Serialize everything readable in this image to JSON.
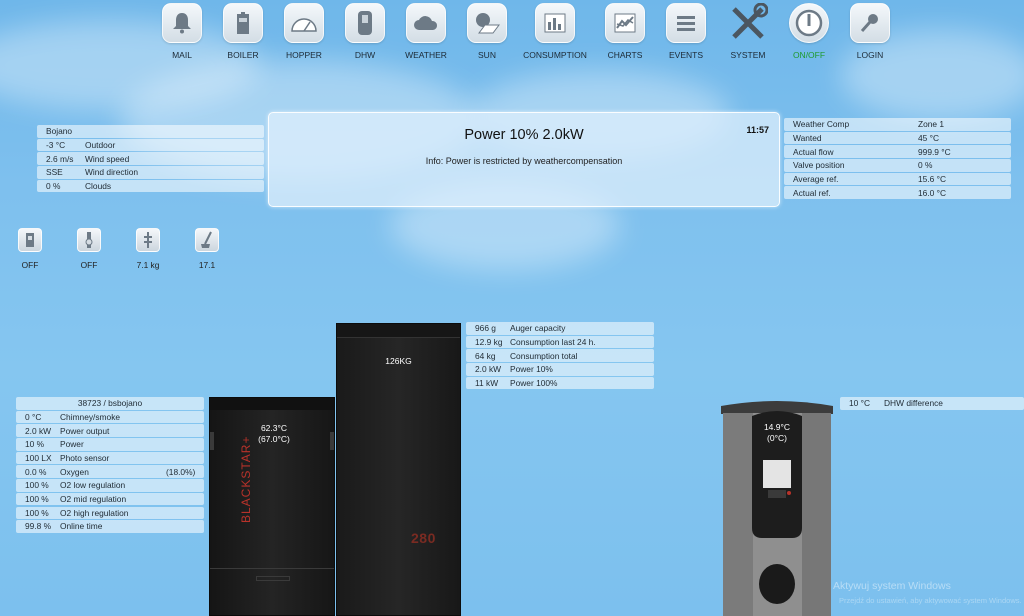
{
  "nav": {
    "items": [
      {
        "label": "MAIL",
        "icon": "bell-icon"
      },
      {
        "label": "BOILER",
        "icon": "boiler-icon"
      },
      {
        "label": "HOPPER",
        "icon": "gauge-icon"
      },
      {
        "label": "DHW",
        "icon": "water-tank-icon"
      },
      {
        "label": "WEATHER",
        "icon": "cloud-icon"
      },
      {
        "label": "SUN",
        "icon": "sun-panel-icon"
      },
      {
        "label": "CONSUMPTION",
        "icon": "bar-chart-icon"
      },
      {
        "label": "CHARTS",
        "icon": "line-chart-icon"
      },
      {
        "label": "EVENTS",
        "icon": "list-icon"
      },
      {
        "label": "SYSTEM",
        "icon": "tools-icon"
      },
      {
        "label": "ON/OFF",
        "icon": "power-icon"
      },
      {
        "label": "LOGIN",
        "icon": "key-icon"
      }
    ]
  },
  "weather": {
    "location": "Bojano",
    "rows": [
      {
        "value": "-3 °C",
        "label": "Outdoor"
      },
      {
        "value": "2.6 m/s",
        "label": "Wind speed"
      },
      {
        "value": "SSE",
        "label": "Wind direction"
      },
      {
        "value": "0 %",
        "label": "Clouds"
      }
    ]
  },
  "info": {
    "title": "Power 10% 2.0kW",
    "time": "11:57",
    "message": "Info: Power is restricted by weathercompensation"
  },
  "weather_comp": {
    "rows": [
      {
        "label": "Weather Comp",
        "value": "Zone 1"
      },
      {
        "label": "Wanted",
        "value": "45 °C"
      },
      {
        "label": "Actual flow",
        "value": "999.9 °C"
      },
      {
        "label": "Valve position",
        "value": "0 %"
      },
      {
        "label": "Average ref.",
        "value": "15.6 °C"
      },
      {
        "label": "Actual ref.",
        "value": "16.0 °C"
      }
    ]
  },
  "devices": [
    {
      "label": "OFF",
      "icon": "pump-icon"
    },
    {
      "label": "OFF",
      "icon": "valve-icon"
    },
    {
      "label": "7.1 kg",
      "icon": "pellet-scale-icon"
    },
    {
      "label": "17.1",
      "icon": "sweeper-icon"
    }
  ],
  "hopper_stats": {
    "rows": [
      {
        "value": "966 g",
        "label": "Auger capacity"
      },
      {
        "value": "12.9 kg",
        "label": "Consumption last 24 h."
      },
      {
        "value": "64 kg",
        "label": "Consumption total"
      },
      {
        "value": "2.0 kW",
        "label": "Power 10%"
      },
      {
        "value": "11 kW",
        "label": "Power 100%"
      }
    ]
  },
  "boiler_stats": {
    "header": "38723 / bsbojano",
    "rows": [
      {
        "value": "0 °C",
        "label": "Chimney/smoke",
        "extra": ""
      },
      {
        "value": "2.0 kW",
        "label": "Power output",
        "extra": ""
      },
      {
        "value": "10 %",
        "label": "Power",
        "extra": ""
      },
      {
        "value": "100 LX",
        "label": "Photo sensor",
        "extra": ""
      },
      {
        "value": "0.0 %",
        "label": "Oxygen",
        "extra": "(18.0%)"
      },
      {
        "value": "100 %",
        "label": "O2 low regulation",
        "extra": ""
      },
      {
        "value": "100 %",
        "label": "O2 mid regulation",
        "extra": ""
      },
      {
        "value": "100 %",
        "label": "O2 high regulation",
        "extra": ""
      },
      {
        "value": "99.8 %",
        "label": "Online time",
        "extra": ""
      }
    ]
  },
  "hopper": {
    "weight": "126KG",
    "number": "280"
  },
  "boiler": {
    "temp": "62.3°C",
    "temp_target": "(67.0°C)",
    "brand": "BLACKSTAR+"
  },
  "dhw": {
    "temp": "14.9°C",
    "temp_target": "(0°C)",
    "difference_value": "10 °C",
    "difference_label": "DHW difference"
  },
  "watermark": {
    "line1": "Aktywuj system Windows",
    "line2": "Przejdź do ustawień, aby aktywować system Windows."
  },
  "colors": {
    "sky": "#7ec0ee",
    "panel": "#ffffff",
    "onoff": "#1f9a2e",
    "brand_red": "#b8322a"
  }
}
